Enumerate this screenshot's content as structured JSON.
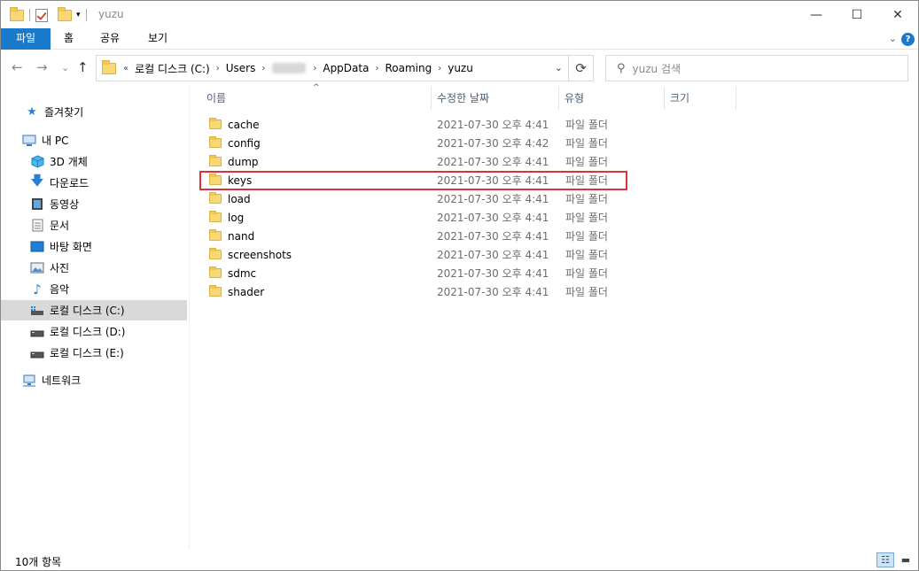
{
  "window": {
    "title": "yuzu",
    "minimize": "—",
    "maximize": "☐",
    "close": "✕"
  },
  "ribbon": {
    "tabs": [
      "파일",
      "홈",
      "공유",
      "보기"
    ],
    "expand_icon": "chevron-down",
    "help": "?"
  },
  "nav": {
    "back": "←",
    "forward": "→",
    "recent": "⌄",
    "up": "↑"
  },
  "address": {
    "overflow": "«",
    "crumbs": [
      "로컬 디스크 (C:)",
      "Users",
      "AppData",
      "Roaming",
      "yuzu"
    ],
    "refresh": "⟳"
  },
  "search": {
    "placeholder": "yuzu 검색"
  },
  "sidebar": {
    "items": [
      {
        "label": "즐겨찾기",
        "icon": "star-icon"
      },
      {
        "label": "내 PC",
        "icon": "computer-icon"
      },
      {
        "label": "3D 개체",
        "icon": "cube-icon"
      },
      {
        "label": "다운로드",
        "icon": "download-icon"
      },
      {
        "label": "동영상",
        "icon": "video-icon"
      },
      {
        "label": "문서",
        "icon": "document-icon"
      },
      {
        "label": "바탕 화면",
        "icon": "desktop-icon"
      },
      {
        "label": "사진",
        "icon": "pictures-icon"
      },
      {
        "label": "음악",
        "icon": "music-icon"
      },
      {
        "label": "로컬 디스크 (C:)",
        "icon": "drive-icon",
        "selected": true
      },
      {
        "label": "로컬 디스크 (D:)",
        "icon": "drive-icon"
      },
      {
        "label": "로컬 디스크 (E:)",
        "icon": "drive-icon"
      },
      {
        "label": "네트워크",
        "icon": "network-icon"
      }
    ]
  },
  "columns": {
    "name": "이름",
    "date": "수정한 날짜",
    "type": "유형",
    "size": "크기"
  },
  "files": [
    {
      "name": "cache",
      "date": "2021-07-30 오후 4:41",
      "type": "파일 폴더"
    },
    {
      "name": "config",
      "date": "2021-07-30 오후 4:42",
      "type": "파일 폴더"
    },
    {
      "name": "dump",
      "date": "2021-07-30 오후 4:41",
      "type": "파일 폴더"
    },
    {
      "name": "keys",
      "date": "2021-07-30 오후 4:41",
      "type": "파일 폴더",
      "highlighted": true
    },
    {
      "name": "load",
      "date": "2021-07-30 오후 4:41",
      "type": "파일 폴더"
    },
    {
      "name": "log",
      "date": "2021-07-30 오후 4:41",
      "type": "파일 폴더"
    },
    {
      "name": "nand",
      "date": "2021-07-30 오후 4:41",
      "type": "파일 폴더"
    },
    {
      "name": "screenshots",
      "date": "2021-07-30 오후 4:41",
      "type": "파일 폴더"
    },
    {
      "name": "sdmc",
      "date": "2021-07-30 오후 4:41",
      "type": "파일 폴더"
    },
    {
      "name": "shader",
      "date": "2021-07-30 오후 4:41",
      "type": "파일 폴더"
    }
  ],
  "status": {
    "count": "10개 항목"
  },
  "colors": {
    "accent": "#1979ca",
    "highlight_border": "#d9323b",
    "selected_nav": "#d9d9d9"
  }
}
